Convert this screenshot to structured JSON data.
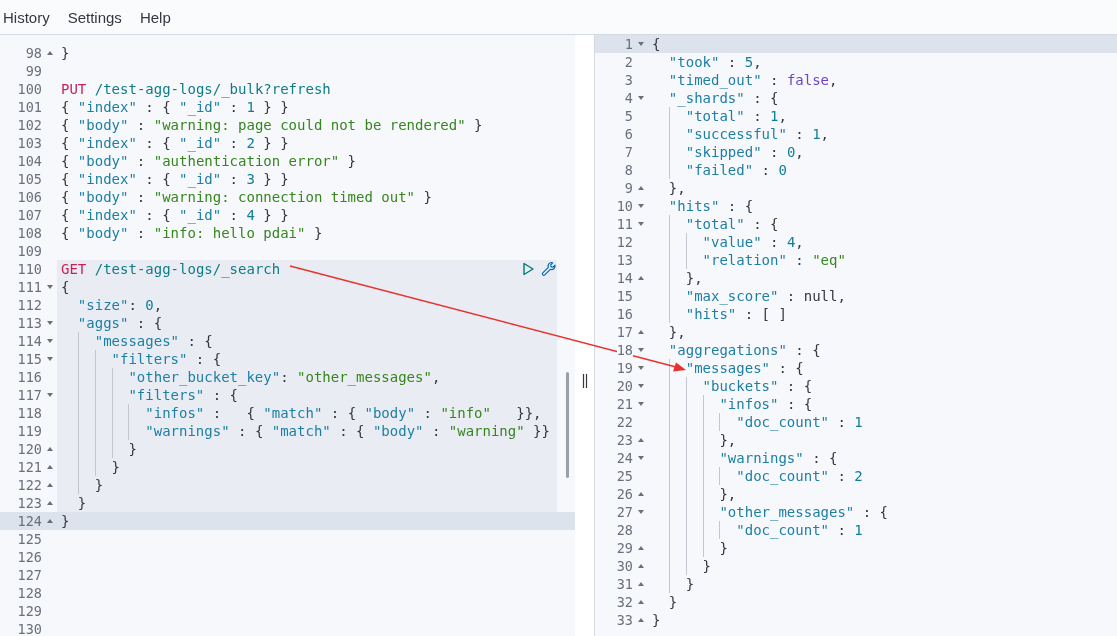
{
  "menu": [
    "History",
    "Settings",
    "Help"
  ],
  "request_editor": {
    "lines": [
      {
        "n": "98",
        "text": "}",
        "fold_end": true,
        "in_request": false,
        "active": false
      },
      {
        "n": "99",
        "in_request": false,
        "active": false
      },
      {
        "n": "100",
        "text": "PUT /test-agg-logs/_bulk?refresh",
        "in_request": false,
        "active": false
      },
      {
        "n": "101",
        "text": "{ \"index\" : { \"_id\" : 1 } }",
        "in_request": false,
        "active": false
      },
      {
        "n": "102",
        "text": "{ \"body\" : \"warning: page could not be rendered\" }",
        "in_request": false,
        "active": false
      },
      {
        "n": "103",
        "text": "{ \"index\" : { \"_id\" : 2 } }",
        "in_request": false,
        "active": false
      },
      {
        "n": "104",
        "text": "{ \"body\" : \"authentication error\" }",
        "in_request": false,
        "active": false
      },
      {
        "n": "105",
        "text": "{ \"index\" : { \"_id\" : 3 } }",
        "in_request": false,
        "active": false
      },
      {
        "n": "106",
        "text": "{ \"body\" : \"warning: connection timed out\" }",
        "in_request": false,
        "active": false
      },
      {
        "n": "107",
        "text": "{ \"index\" : { \"_id\" : 4 } }",
        "in_request": false,
        "active": false
      },
      {
        "n": "108",
        "text": "{ \"body\" : \"info: hello pdai\" }",
        "in_request": false,
        "active": false
      },
      {
        "n": "109",
        "in_request": false,
        "active": false
      },
      {
        "n": "110",
        "text": "GET /test-agg-logs/_search",
        "in_request": true,
        "active": false
      },
      {
        "n": "111",
        "text": "{",
        "fold_start": true,
        "in_request": true,
        "active": false
      },
      {
        "n": "112",
        "text": "  \"size\": 0,",
        "in_request": true,
        "active": false
      },
      {
        "n": "113",
        "text": "  \"aggs\" : {",
        "fold_start": true,
        "in_request": true,
        "active": false
      },
      {
        "n": "114",
        "text": "    \"messages\" : {",
        "fold_start": true,
        "in_request": true,
        "active": false
      },
      {
        "n": "115",
        "text": "      \"filters\" : {",
        "fold_start": true,
        "in_request": true,
        "active": false
      },
      {
        "n": "116",
        "text": "        \"other_bucket_key\": \"other_messages\",",
        "in_request": true,
        "active": false
      },
      {
        "n": "117",
        "text": "        \"filters\" : {",
        "fold_start": true,
        "in_request": true,
        "active": false
      },
      {
        "n": "118",
        "text": "          \"infos\" :   { \"match\" : { \"body\" : \"info\"   }},",
        "in_request": true,
        "active": false
      },
      {
        "n": "119",
        "text": "          \"warnings\" : { \"match\" : { \"body\" : \"warning\" }}",
        "in_request": true,
        "active": false
      },
      {
        "n": "120",
        "text": "        }",
        "fold_end": true,
        "in_request": true,
        "active": false
      },
      {
        "n": "121",
        "text": "      }",
        "fold_end": true,
        "in_request": true,
        "active": false
      },
      {
        "n": "122",
        "text": "    }",
        "fold_end": true,
        "in_request": true,
        "active": false
      },
      {
        "n": "123",
        "text": "  }",
        "fold_end": true,
        "in_request": true,
        "active": false
      },
      {
        "n": "124",
        "text": "}",
        "fold_end": true,
        "in_request": true,
        "active": true
      },
      {
        "n": "125",
        "in_request": false,
        "active": false
      },
      {
        "n": "126",
        "in_request": false,
        "active": false
      },
      {
        "n": "127",
        "in_request": false,
        "active": false
      },
      {
        "n": "128",
        "in_request": false,
        "active": false
      },
      {
        "n": "129",
        "in_request": false,
        "active": false
      },
      {
        "n": "130",
        "in_request": false,
        "active": false
      }
    ]
  },
  "response_viewer": {
    "lines": [
      {
        "n": "1",
        "text": "{",
        "fold_start": true,
        "active": true
      },
      {
        "n": "2",
        "text": "  \"took\" : 5,",
        "active": false
      },
      {
        "n": "3",
        "text": "  \"timed_out\" : false,",
        "active": false
      },
      {
        "n": "4",
        "text": "  \"_shards\" : {",
        "fold_start": true,
        "active": false
      },
      {
        "n": "5",
        "text": "    \"total\" : 1,",
        "active": false
      },
      {
        "n": "6",
        "text": "    \"successful\" : 1,",
        "active": false
      },
      {
        "n": "7",
        "text": "    \"skipped\" : 0,",
        "active": false
      },
      {
        "n": "8",
        "text": "    \"failed\" : 0",
        "active": false
      },
      {
        "n": "9",
        "text": "  },",
        "fold_end": true,
        "active": false
      },
      {
        "n": "10",
        "text": "  \"hits\" : {",
        "fold_start": true,
        "active": false
      },
      {
        "n": "11",
        "text": "    \"total\" : {",
        "fold_start": true,
        "active": false
      },
      {
        "n": "12",
        "text": "      \"value\" : 4,",
        "active": false
      },
      {
        "n": "13",
        "text": "      \"relation\" : \"eq\"",
        "active": false
      },
      {
        "n": "14",
        "text": "    },",
        "fold_end": true,
        "active": false
      },
      {
        "n": "15",
        "text": "    \"max_score\" : null,",
        "active": false
      },
      {
        "n": "16",
        "text": "    \"hits\" : [ ]",
        "active": false
      },
      {
        "n": "17",
        "text": "  },",
        "fold_end": true,
        "active": false
      },
      {
        "n": "18",
        "text": "  \"aggregations\" : {",
        "fold_start": true,
        "active": false
      },
      {
        "n": "19",
        "text": "    \"messages\" : {",
        "fold_start": true,
        "active": false
      },
      {
        "n": "20",
        "text": "      \"buckets\" : {",
        "fold_start": true,
        "active": false
      },
      {
        "n": "21",
        "text": "        \"infos\" : {",
        "fold_start": true,
        "active": false
      },
      {
        "n": "22",
        "text": "          \"doc_count\" : 1",
        "active": false
      },
      {
        "n": "23",
        "text": "        },",
        "fold_end": true,
        "active": false
      },
      {
        "n": "24",
        "text": "        \"warnings\" : {",
        "fold_start": true,
        "active": false
      },
      {
        "n": "25",
        "text": "          \"doc_count\" : 2",
        "active": false
      },
      {
        "n": "26",
        "text": "        },",
        "fold_end": true,
        "active": false
      },
      {
        "n": "27",
        "text": "        \"other_messages\" : {",
        "fold_start": true,
        "active": false
      },
      {
        "n": "28",
        "text": "          \"doc_count\" : 1",
        "active": false
      },
      {
        "n": "29",
        "text": "        }",
        "fold_end": true,
        "active": false
      },
      {
        "n": "30",
        "text": "      }",
        "fold_end": true,
        "active": false
      },
      {
        "n": "31",
        "text": "    }",
        "fold_end": true,
        "active": false
      },
      {
        "n": "32",
        "text": "  }",
        "fold_end": true,
        "active": false
      },
      {
        "n": "33",
        "text": "}",
        "fold_end": true,
        "active": false
      }
    ]
  }
}
